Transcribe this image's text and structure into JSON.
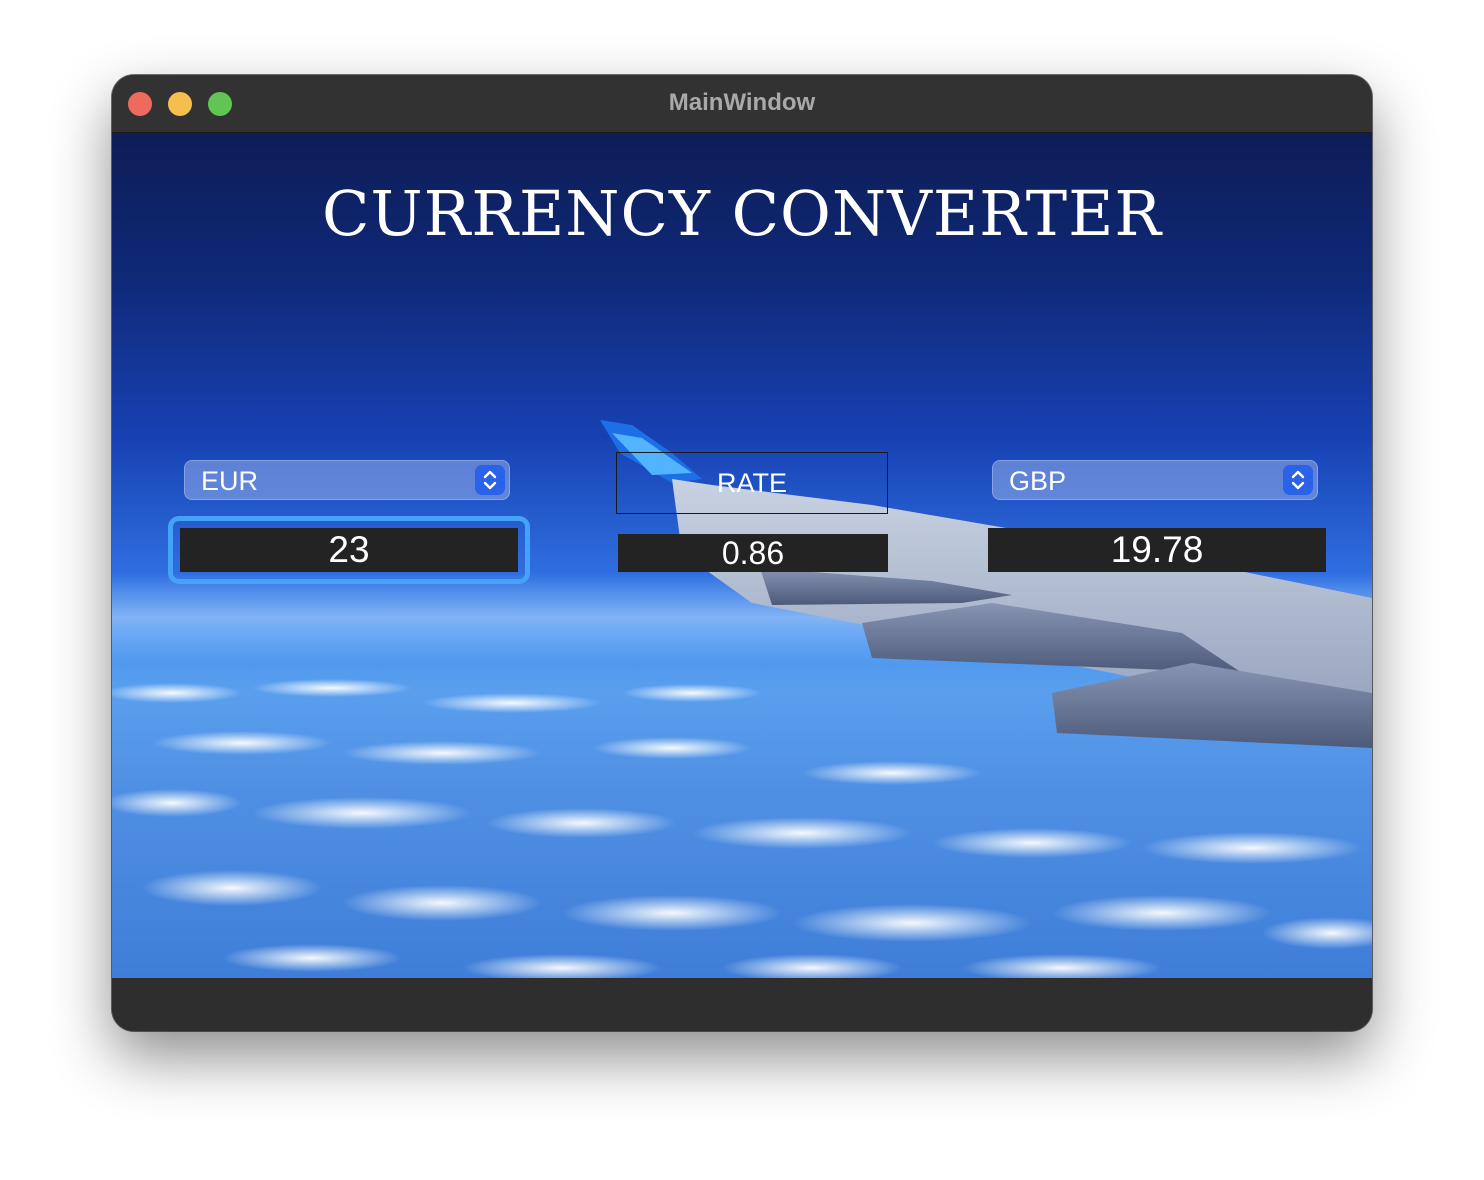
{
  "window": {
    "title": "MainWindow"
  },
  "app": {
    "heading": "CURRENCY CONVERTER"
  },
  "from_currency": {
    "selected": "EUR",
    "amount": "23"
  },
  "rate": {
    "label": "RATE",
    "value": "0.86"
  },
  "to_currency": {
    "selected": "GBP",
    "amount": "19.78"
  },
  "colors": {
    "focus_ring": "#45a3f7",
    "combo_arrow_bg": "#2a63e8",
    "field_bg": "#232323",
    "close": "#ed6a5e",
    "minimize": "#f5bf4f",
    "maximize": "#61c554"
  },
  "icons": {
    "combo_arrows": "chevron-up-down-icon"
  }
}
